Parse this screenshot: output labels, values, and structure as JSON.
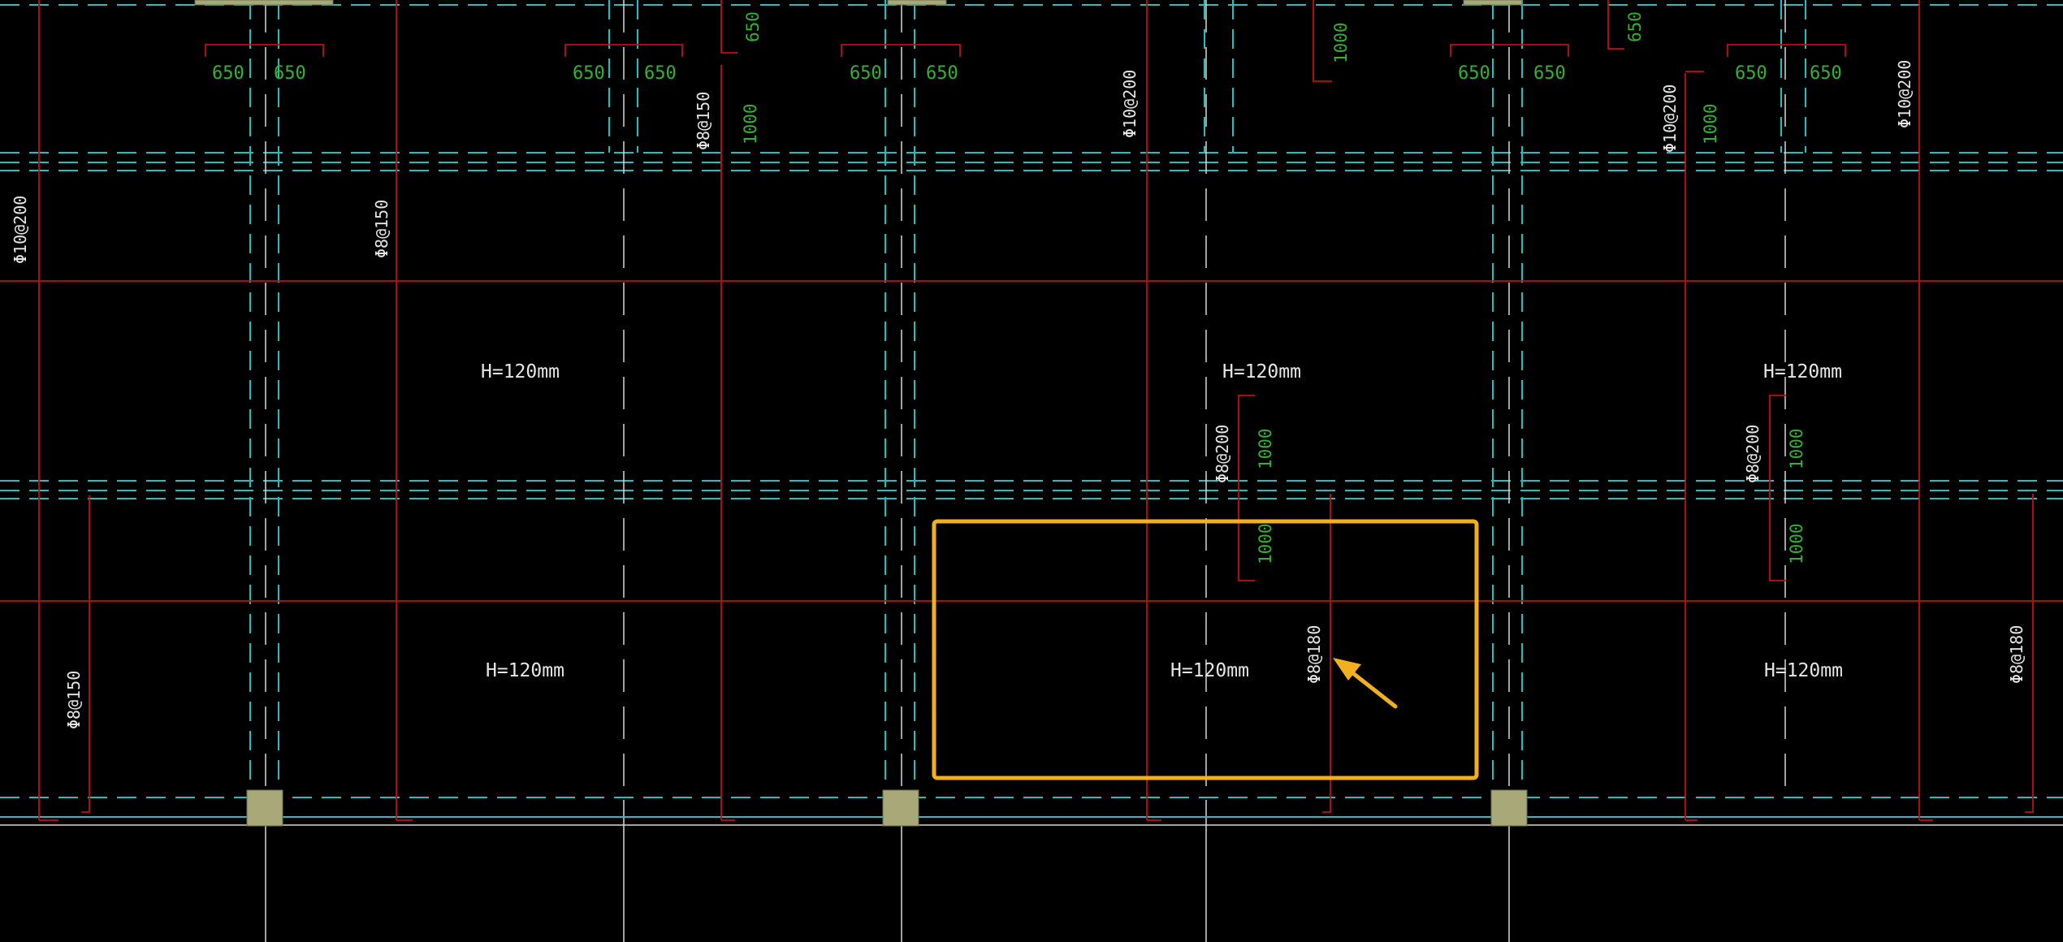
{
  "colors": {
    "background": "#000000",
    "beam_dashed": "#20c0c0",
    "axis": "#ffffff",
    "rebar": "#c01010",
    "dimension_text": "#2fb52f",
    "label_text": "#e6e6e6",
    "column_fill": "#a8a878",
    "highlight": "#f0b020"
  },
  "slab_labels": {
    "s1": "H=120mm",
    "s2": "H=120mm",
    "s3": "H=120mm",
    "s4": "H=120mm",
    "s5": "H=120mm",
    "s6": "H=120mm"
  },
  "rebar_labels": {
    "r1": "Φ10@200",
    "r2": "Φ8@150",
    "r3": "Φ8@150",
    "r4": "Φ10@200",
    "r5": "Φ10@200",
    "r6": "Φ10@200",
    "r7": "Φ8@200",
    "r8": "Φ8@200",
    "r9": "Φ8@150",
    "r10": "Φ8@180",
    "r11": "Φ8@180"
  },
  "dimensions": {
    "d1": "650",
    "d2": "650",
    "d3": "650",
    "d4": "650",
    "d5": "650",
    "d6": "1000",
    "d7": "650",
    "d8": "650",
    "d9": "1000",
    "d10": "650",
    "d11": "650",
    "d12": "650",
    "d13": "1000",
    "d14": "650",
    "d15": "650",
    "d16": "1000",
    "d17": "1000",
    "d18": "1000",
    "d19": "1000"
  },
  "annotation": {
    "highlight_box": "selected-slab-region",
    "arrow": "pointer-arrow"
  }
}
